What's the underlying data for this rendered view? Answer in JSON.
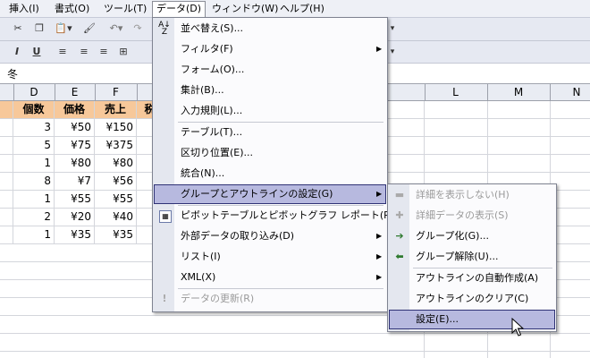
{
  "menubar": {
    "items": [
      "挿入(I)",
      "書式(O)",
      "ツール(T)",
      "データ(D)",
      "ウィンドウ(W)",
      "ヘルプ(H)"
    ]
  },
  "toolbar2": {
    "italic": "I",
    "underline": "U"
  },
  "formula": {
    "value": "冬"
  },
  "columns": [
    "D",
    "E",
    "F",
    "L",
    "M",
    "N"
  ],
  "sheet": {
    "header_row": [
      "個数",
      "価格",
      "売上",
      "税"
    ],
    "rows": [
      [
        "3",
        "¥50",
        "¥150"
      ],
      [
        "5",
        "¥75",
        "¥375"
      ],
      [
        "1",
        "¥80",
        "¥80"
      ],
      [
        "8",
        "¥7",
        "¥56"
      ],
      [
        "1",
        "¥55",
        "¥55"
      ],
      [
        "2",
        "¥20",
        "¥40"
      ],
      [
        "1",
        "¥35",
        "¥35"
      ]
    ]
  },
  "data_menu": {
    "items": [
      {
        "label": "並べ替え(S)...",
        "icon": "sort-icon"
      },
      {
        "label": "フィルタ(F)",
        "submenu": true
      },
      {
        "label": "フォーム(O)..."
      },
      {
        "label": "集計(B)..."
      },
      {
        "label": "入力規則(L)..."
      },
      {
        "label": "テーブル(T)..."
      },
      {
        "label": "区切り位置(E)..."
      },
      {
        "label": "統合(N)..."
      },
      {
        "label": "グループとアウトラインの設定(G)",
        "submenu": true,
        "highlighted": true
      },
      {
        "label": "ピボットテーブルとピボットグラフ レポート(P)...",
        "icon": "pivot-icon"
      },
      {
        "label": "外部データの取り込み(D)",
        "submenu": true
      },
      {
        "label": "リスト(I)",
        "submenu": true
      },
      {
        "label": "XML(X)",
        "submenu": true
      },
      {
        "label": "データの更新(R)",
        "disabled": true,
        "icon": "refresh-icon"
      }
    ]
  },
  "outline_submenu": {
    "items": [
      {
        "label": "詳細を表示しない(H)",
        "disabled": true,
        "icon": "hide-detail-icon"
      },
      {
        "label": "詳細データの表示(S)",
        "disabled": true,
        "icon": "show-detail-icon"
      },
      {
        "label": "グループ化(G)...",
        "icon": "group-icon"
      },
      {
        "label": "グループ解除(U)...",
        "icon": "ungroup-icon"
      },
      {
        "label": "アウトラインの自動作成(A)"
      },
      {
        "label": "アウトラインのクリア(C)"
      },
      {
        "label": "設定(E)...",
        "highlighted": true
      }
    ]
  },
  "colors": {
    "header_fill": "#f7c89a",
    "highlight": "#b7b9df",
    "highlight_border": "#2f3275"
  }
}
